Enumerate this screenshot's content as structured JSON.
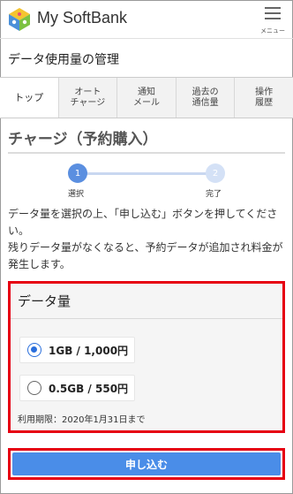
{
  "header": {
    "app_title": "My SoftBank",
    "menu_label": "メニュー",
    "logo_icon": "softbank-logo-icon",
    "menu_icon": "hamburger-menu-icon"
  },
  "page": {
    "title": "データ使用量の管理"
  },
  "tabs": [
    {
      "label": "トップ",
      "active": true
    },
    {
      "label": "オート\nチャージ",
      "active": false
    },
    {
      "label": "通知\nメール",
      "active": false
    },
    {
      "label": "過去の\n通信量",
      "active": false
    },
    {
      "label": "操作\n履歴",
      "active": false
    }
  ],
  "section": {
    "title": "チャージ（予約購入）"
  },
  "stepper": {
    "steps": [
      {
        "number": "1",
        "label": "選択",
        "active": true
      },
      {
        "number": "2",
        "label": "完了",
        "active": false
      }
    ]
  },
  "description": {
    "line1": "データ量を選択の上、「申し込む」ボタンを押してください。",
    "line2": "残りデータ量がなくなると、予約データが追加され料金が発生します。"
  },
  "data_amount": {
    "heading": "データ量",
    "options": [
      {
        "label": "1GB / 1,000円",
        "selected": true
      },
      {
        "label": "0.5GB / 550円",
        "selected": false
      }
    ],
    "expiry": "利用期限：2020年1月31日まで"
  },
  "submit": {
    "label": "申し込む"
  },
  "colors": {
    "accent_blue": "#4a8de8",
    "highlight_red": "#e60012",
    "radio_blue": "#2a6fdc"
  }
}
